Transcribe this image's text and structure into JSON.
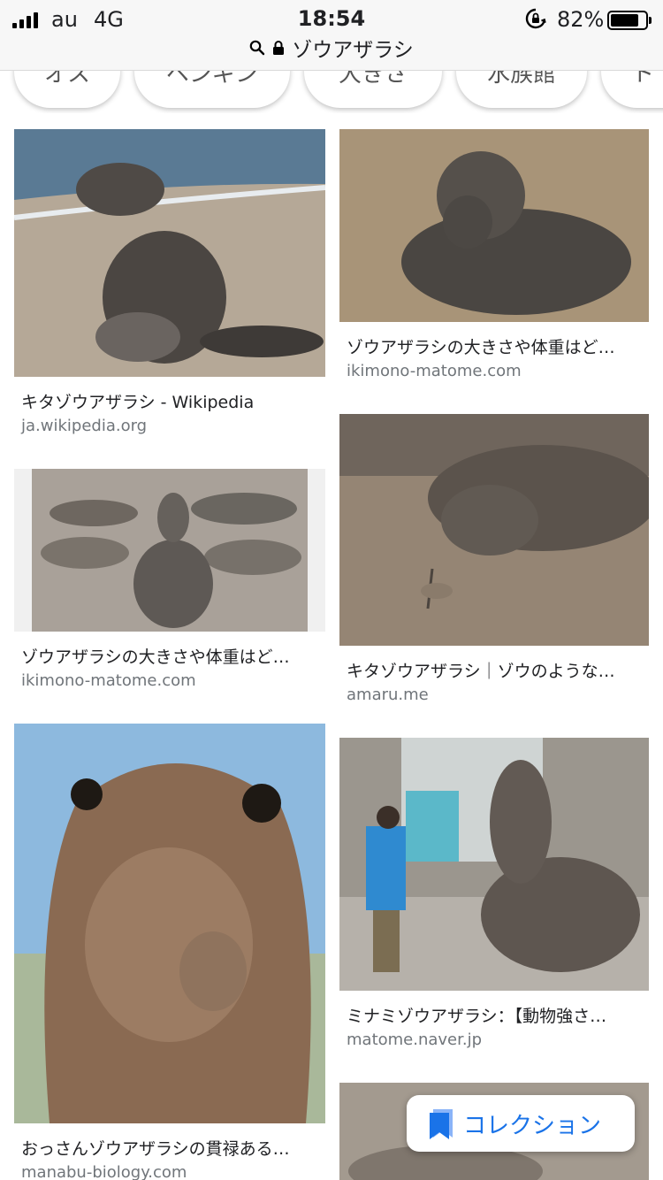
{
  "status_bar": {
    "carrier": "au",
    "network": "4G",
    "time": "18:54",
    "battery_percent": "82%",
    "battery_level": 0.82
  },
  "url_bar": {
    "query": "ゾウアザラシ"
  },
  "chips": [
    "オス",
    "ペンギン",
    "大きさ",
    "水族館",
    "ト"
  ],
  "results": [
    {
      "title": "キタゾウアザラシ - Wikipedia",
      "domain": "ja.wikipedia.org"
    },
    {
      "title": "ゾウアザラシの大きさや体重はど…",
      "domain": "ikimono-matome.com"
    },
    {
      "title": "ゾウアザラシの大きさや体重はど…",
      "domain": "ikimono-matome.com"
    },
    {
      "title": "キタゾウアザラシ｜ゾウのような…",
      "domain": "amaru.me"
    },
    {
      "title": "おっさんゾウアザラシの貫禄ある…",
      "domain": "manabu-biology.com"
    },
    {
      "title": "ミナミゾウアザラシ：【動物強さ…",
      "domain": "matome.naver.jp"
    }
  ],
  "collection_button": {
    "label": "コレクション",
    "icon": "bookmark-icon"
  },
  "colors": {
    "accent": "#1a73e8",
    "domain_text": "#70757a"
  }
}
